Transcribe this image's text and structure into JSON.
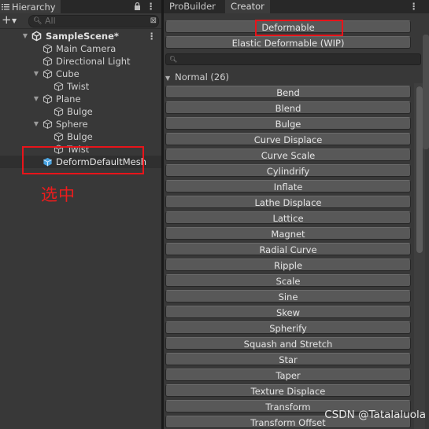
{
  "hierarchy": {
    "tab_title": "Hierarchy",
    "add_label": "+",
    "search_placeholder": "All",
    "scene": "SampleScene*",
    "items": [
      {
        "label": "Main Camera"
      },
      {
        "label": "Directional Light"
      },
      {
        "label": "Cube"
      },
      {
        "label": "Twist"
      },
      {
        "label": "Plane"
      },
      {
        "label": "Bulge"
      },
      {
        "label": "Sphere"
      },
      {
        "label": "Bulge"
      },
      {
        "label": "Twist"
      },
      {
        "label": "DeformDefaultMesh"
      }
    ],
    "annotation": "选中"
  },
  "tabs": [
    "ProBuilder",
    "Creator"
  ],
  "creator": {
    "deformable_button": "Deformable",
    "elastic_button": "Elastic Deformable (WIP)",
    "group_label": "Normal (26)",
    "deformers": [
      "Bend",
      "Blend",
      "Bulge",
      "Curve Displace",
      "Curve Scale",
      "Cylindrify",
      "Inflate",
      "Lathe Displace",
      "Lattice",
      "Magnet",
      "Radial Curve",
      "Ripple",
      "Scale",
      "Sine",
      "Skew",
      "Spherify",
      "Squash and Stretch",
      "Star",
      "Taper",
      "Texture Displace",
      "Transform",
      "Transform Offset"
    ]
  },
  "watermark": "CSDN @Tatalaluola",
  "colors": {
    "highlight_red": "#e8141a",
    "panel_bg": "#383838",
    "button_bg": "#585858"
  }
}
